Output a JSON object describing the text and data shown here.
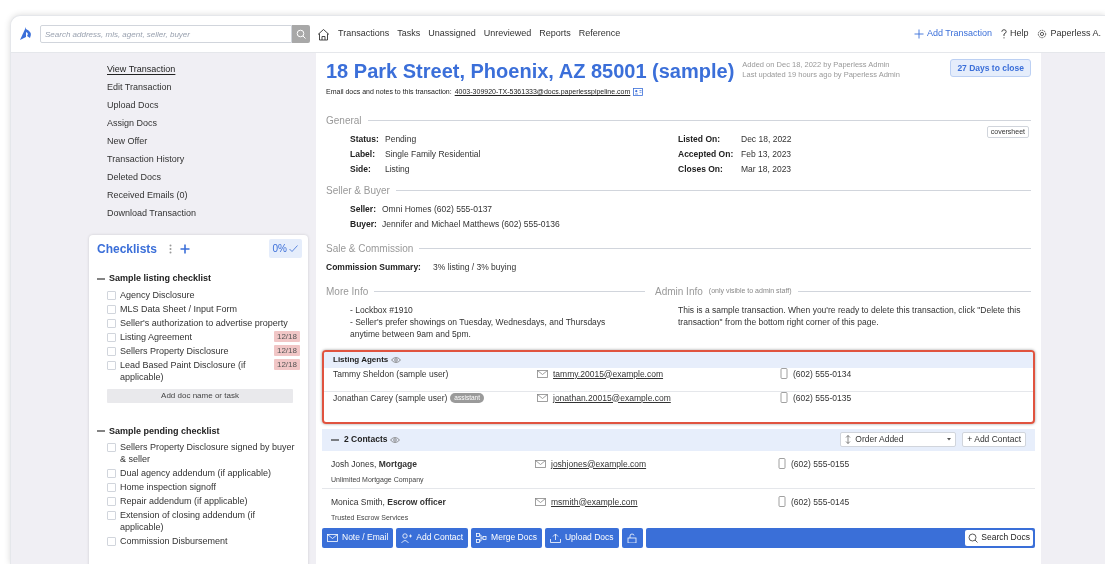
{
  "search": {
    "placeholder": "Search address, mls, agent, seller, buyer"
  },
  "nav": {
    "items": [
      "Transactions",
      "Tasks",
      "Unassigned",
      "Unreviewed",
      "Reports",
      "Reference"
    ],
    "add_transaction": "Add Transaction",
    "help": "Help",
    "user": "Paperless A."
  },
  "sidebar": {
    "links": [
      {
        "label": "View Transaction",
        "selected": true
      },
      {
        "label": "Edit Transaction",
        "selected": false
      },
      {
        "label": "Upload Docs",
        "selected": false
      },
      {
        "label": "Assign Docs",
        "selected": false
      },
      {
        "label": "New Offer",
        "selected": false
      },
      {
        "label": "Transaction History",
        "selected": false
      },
      {
        "label": "Deleted Docs",
        "selected": false
      },
      {
        "label": "Received Emails (0)",
        "selected": false
      },
      {
        "label": "Download Transaction",
        "selected": false
      }
    ]
  },
  "checklists": {
    "title": "Checklists",
    "progress": "0%",
    "groups": [
      {
        "title": "Sample listing checklist",
        "add_label": "Add doc name or task",
        "items": [
          {
            "label": "Agency Disclosure",
            "checked": false
          },
          {
            "label": "MLS Data Sheet / Input Form",
            "checked": false
          },
          {
            "label": "Seller's authorization to advertise property",
            "checked": false
          },
          {
            "label": "Listing Agreement",
            "checked": false,
            "badge": "12/18"
          },
          {
            "label": "Sellers Property Disclosure",
            "checked": false,
            "badge": "12/18"
          },
          {
            "label": "Lead Based Paint Disclosure (if applicable)",
            "checked": false,
            "badge": "12/18"
          }
        ]
      },
      {
        "title": "Sample pending checklist",
        "items": [
          {
            "label": "Sellers Property Disclosure signed by buyer & seller",
            "checked": false
          },
          {
            "label": "Dual agency addendum (if applicable)",
            "checked": false
          },
          {
            "label": "Home inspection signoff",
            "checked": false
          },
          {
            "label": "Repair addendum (if applicable)",
            "checked": false
          },
          {
            "label": "Extension of closing addendum (if applicable)",
            "checked": false
          },
          {
            "label": "Commission Disbursement",
            "checked": false
          }
        ]
      }
    ]
  },
  "transaction": {
    "title": "18 Park Street, Phoenix, AZ 85001 (sample)",
    "added": "Added on Dec 18, 2022 by Paperless Admin",
    "updated": "Last updated 19 hours ago by Paperless Admin",
    "days_to_close": "27 Days to close",
    "email_prefix": "Email docs and notes to this transaction:",
    "email_address": "4003-309920-TX-5361333@docs.paperlesspipeline.com"
  },
  "general": {
    "title": "General",
    "coversheet": "coversheet",
    "left": [
      {
        "label": "Status:",
        "value": "Pending"
      },
      {
        "label": "Label:",
        "value": "Single Family Residential"
      },
      {
        "label": "Side:",
        "value": "Listing"
      }
    ],
    "right": [
      {
        "label": "Listed On:",
        "value": "Dec 18, 2022"
      },
      {
        "label": "Accepted On:",
        "value": "Feb 13, 2023"
      },
      {
        "label": "Closes On:",
        "value": "Mar 18, 2023"
      }
    ]
  },
  "seller_buyer": {
    "title": "Seller & Buyer",
    "fields": [
      {
        "label": "Seller:",
        "value": "Omni Homes (602) 555-0137"
      },
      {
        "label": "Buyer:",
        "value": "Jennifer and Michael Matthews (602) 555-0136"
      }
    ]
  },
  "sale_commission": {
    "title": "Sale & Commission",
    "label": "Commission Summary:",
    "value": "3% listing / 3% buying"
  },
  "more_info": {
    "title": "More Info",
    "lines": [
      "- Lockbox #1910",
      "- Seller's prefer showings on Tuesday, Wednesdays, and Thursdays anytime between 9am and 5pm."
    ]
  },
  "admin_info": {
    "title": "Admin Info",
    "note": "(only visible to admin staff)",
    "text": "This is a sample transaction. When you're ready to delete this transaction, click \"Delete this transaction\" from the bottom right corner of this page."
  },
  "listing_agents": {
    "title": "Listing Agents",
    "highlighted": true,
    "rows": [
      {
        "name": "Tammy Sheldon (sample user)",
        "email": "tammy.20015@example.com",
        "phone": "(602) 555-0134"
      },
      {
        "name": "Jonathan Carey (sample user)",
        "badge": "assistant",
        "email": "jonathan.20015@example.com",
        "phone": "(602) 555-0135"
      }
    ]
  },
  "contacts": {
    "title": "2 Contacts",
    "expanded": true,
    "sort": "Order Added",
    "add_button": "+ Add Contact",
    "rows": [
      {
        "name": "Josh Jones, ",
        "role": "Mortgage",
        "company": "Unlimited Mortgage Company",
        "email": "joshjones@example.com",
        "phone": "(602) 555-0155"
      },
      {
        "name": "Monica Smith, ",
        "role": "Escrow officer",
        "company": "Trusted Escrow Services",
        "email": "msmith@example.com",
        "phone": "(602) 555-0145"
      }
    ]
  },
  "toolbar": {
    "buttons": [
      {
        "kind": "note",
        "label": "Note / Email"
      },
      {
        "kind": "contact",
        "label": "Add Contact"
      },
      {
        "kind": "merge",
        "label": "Merge Docs"
      },
      {
        "kind": "upload",
        "label": "Upload Docs"
      },
      {
        "kind": "lock"
      }
    ],
    "search": "Search Docs"
  }
}
